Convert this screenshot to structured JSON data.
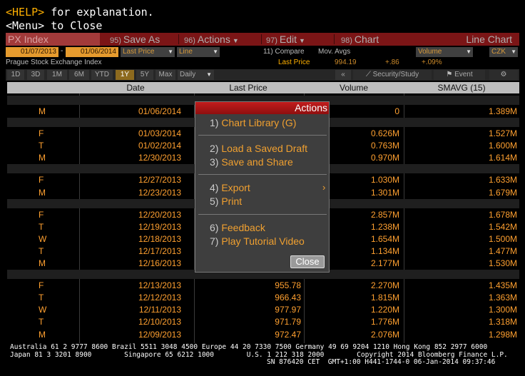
{
  "help_line": {
    "key": "<HELP>",
    "text": " for explanation."
  },
  "menu_line": "<Menu> to Close",
  "title_bar": {
    "index": "PX Index",
    "save_as": {
      "num": "95)",
      "label": "Save As"
    },
    "actions": {
      "num": "96)",
      "label": "Actions"
    },
    "edit": {
      "num": "97)",
      "label": "Edit"
    },
    "chart": {
      "num": "98)",
      "label": "Chart"
    },
    "mode": "Line Chart"
  },
  "controls": {
    "start_date": "01/07/2013",
    "dash": "-",
    "end_date": "01/06/2014",
    "price_field": "Last Price",
    "chart_type": "Line",
    "compare": "11) Compare",
    "mov_avgs": "Mov. Avgs",
    "volume": "Volume",
    "currency": "CZK",
    "security_name": "Prague Stock Exchange Index",
    "legend_label": "Last Price",
    "legend_value": "994.19",
    "legend_change": "+.86",
    "legend_pct": "+.09%"
  },
  "range_buttons": [
    "1D",
    "3D",
    "1M",
    "6M",
    "YTD",
    "1Y",
    "5Y",
    "Max"
  ],
  "range_selected": "1Y",
  "period": "Daily",
  "toolbar": {
    "collapse": "«",
    "security_study": "Security/Study",
    "event": "Event"
  },
  "table": {
    "headers": [
      "Date",
      "Last Price",
      "Volume",
      "SMAVG (15)"
    ],
    "groups": [
      [
        {
          "day": "M",
          "date": "01/06/2014",
          "last": "",
          "volume": "0",
          "smavg": "1.389M"
        }
      ],
      [
        {
          "day": "F",
          "date": "01/03/2014",
          "last": "",
          "volume": "0.626M",
          "smavg": "1.527M"
        },
        {
          "day": "T",
          "date": "01/02/2014",
          "last": "",
          "volume": "0.763M",
          "smavg": "1.600M"
        },
        {
          "day": "M",
          "date": "12/30/2013",
          "last": "",
          "volume": "0.970M",
          "smavg": "1.614M"
        }
      ],
      [
        {
          "day": "F",
          "date": "12/27/2013",
          "last": "",
          "volume": "1.030M",
          "smavg": "1.633M"
        },
        {
          "day": "M",
          "date": "12/23/2013",
          "last": "",
          "volume": "1.301M",
          "smavg": "1.679M"
        }
      ],
      [
        {
          "day": "F",
          "date": "12/20/2013",
          "last": "",
          "volume": "2.857M",
          "smavg": "1.678M"
        },
        {
          "day": "T",
          "date": "12/19/2013",
          "last": "",
          "volume": "1.238M",
          "smavg": "1.542M"
        },
        {
          "day": "W",
          "date": "12/18/2013",
          "last": "",
          "volume": "1.654M",
          "smavg": "1.500M"
        },
        {
          "day": "T",
          "date": "12/17/2013",
          "last": "",
          "volume": "1.134M",
          "smavg": "1.477M"
        },
        {
          "day": "M",
          "date": "12/16/2013",
          "last": "",
          "volume": "2.177M",
          "smavg": "1.530M"
        }
      ],
      [
        {
          "day": "F",
          "date": "12/13/2013",
          "last": "955.78",
          "volume": "2.270M",
          "smavg": "1.435M"
        },
        {
          "day": "T",
          "date": "12/12/2013",
          "last": "966.43",
          "volume": "1.815M",
          "smavg": "1.363M"
        },
        {
          "day": "W",
          "date": "12/11/2013",
          "last": "977.97",
          "volume": "1.220M",
          "smavg": "1.300M"
        },
        {
          "day": "T",
          "date": "12/10/2013",
          "last": "971.79",
          "volume": "1.776M",
          "smavg": "1.318M"
        },
        {
          "day": "M",
          "date": "12/09/2013",
          "last": "972.47",
          "volume": "2.076M",
          "smavg": "1.298M"
        }
      ]
    ]
  },
  "actions_popup": {
    "title": "Actions",
    "items": [
      {
        "num": "1)",
        "label": "Chart Library (G)"
      },
      {
        "num": "2)",
        "label": "Load a Saved Draft"
      },
      {
        "num": "3)",
        "label": "Save and Share"
      },
      {
        "num": "4)",
        "label": "Export"
      },
      {
        "num": "5)",
        "label": "Print"
      },
      {
        "num": "6)",
        "label": "Feedback"
      },
      {
        "num": "7)",
        "label": "Play Tutorial Video"
      }
    ],
    "close": "Close"
  },
  "footer": {
    "line1": "Australia 61 2 9777 8600 Brazil 5511 3048 4500 Europe 44 20 7330 7500 Germany 49 69 9204 1210 Hong Kong 852 2977 6000",
    "line2": "Japan 81 3 3201 8900        Singapore 65 6212 1000        U.S. 1 212 318 2000        Copyright 2014 Bloomberg Finance L.P.",
    "line3": "SN 876420 CET  GMT+1:00 H441-1744-0 06-Jan-2014 09:37:46"
  },
  "colors": {
    "accent": "#ffa030",
    "title_red": "#7b1516",
    "selected_range": "#8d6a1e"
  }
}
